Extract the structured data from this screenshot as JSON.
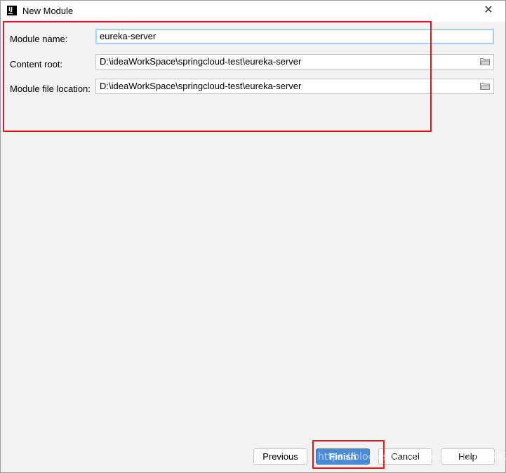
{
  "window": {
    "title": "New Module",
    "app_icon_text": "IJ"
  },
  "form": {
    "module_name": {
      "label": "Module name:",
      "value": "eureka-server"
    },
    "content_root": {
      "label": "Content root:",
      "value": "D:\\ideaWorkSpace\\springcloud-test\\eureka-server"
    },
    "module_file_location": {
      "label": "Module file location:",
      "value": "D:\\ideaWorkSpace\\springcloud-test\\eureka-server"
    }
  },
  "buttons": {
    "previous": "Previous",
    "finish": "Finish",
    "cancel": "Cancel",
    "help": "Help"
  },
  "watermark": "https://blog.csdn.net/weixin_42186447",
  "colors": {
    "highlight_red": "#e8151b",
    "primary_button": "#4c8bd4",
    "focus_border": "#a8cdf2"
  }
}
